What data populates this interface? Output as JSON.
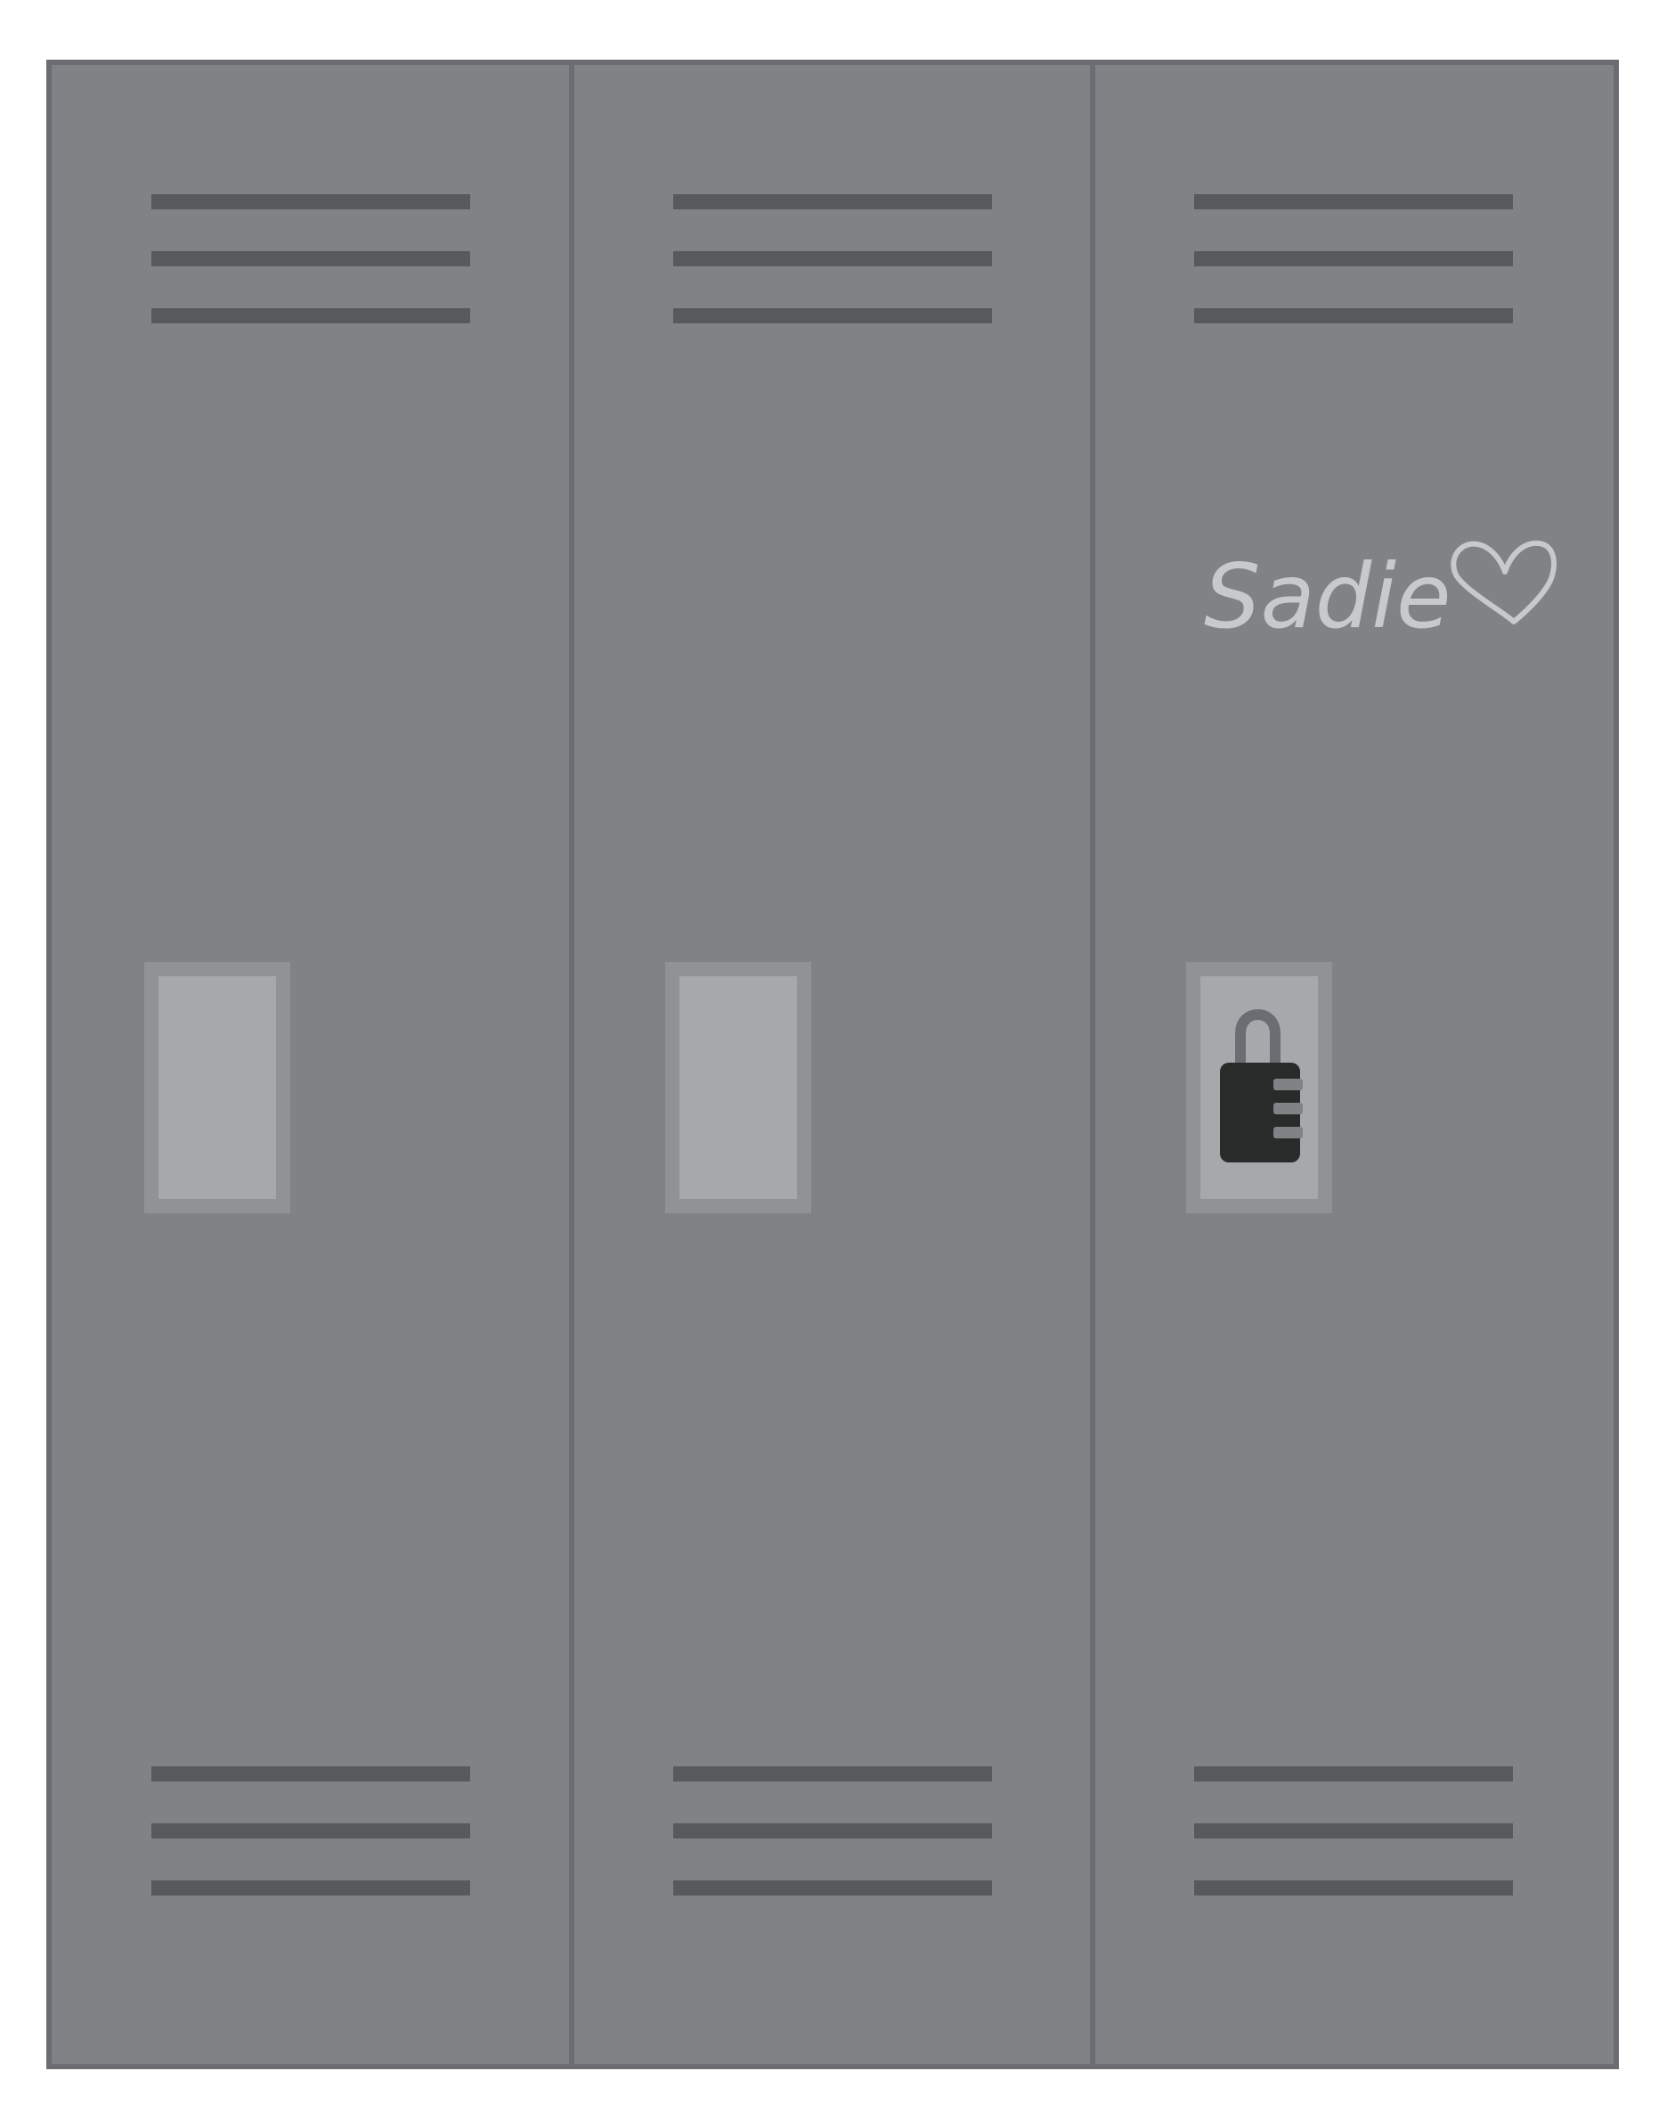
{
  "colors": {
    "background": "#ffffff",
    "locker_body": "#818286",
    "locker_outline": "#6c6d72",
    "vent": "#58595c",
    "handle_frame": "#919296",
    "handle_plate": "#a7a8ac",
    "lock_body": "#292b2a",
    "lock_shackle": "#6c6d72",
    "lock_dial": "#818286",
    "writing": "#c8c9cb"
  },
  "lockers": [
    {
      "id": "left",
      "has_lock": false
    },
    {
      "id": "middle",
      "has_lock": false
    },
    {
      "id": "right",
      "has_lock": true
    }
  ],
  "writing": {
    "text": "Sadie",
    "icon": "heart-icon"
  },
  "lock_icon": "combination-padlock-icon"
}
